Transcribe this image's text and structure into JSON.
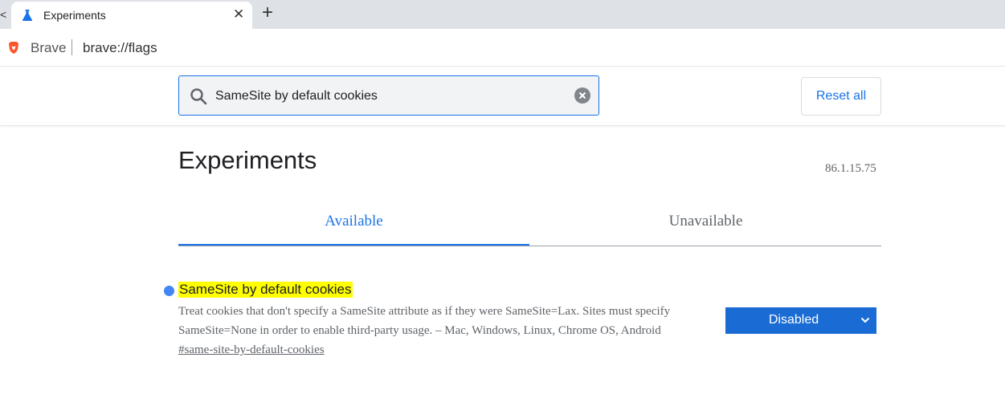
{
  "tabstrip": {
    "scroll_glyph": "<",
    "tab_title": "Experiments",
    "close_glyph": "✕",
    "new_tab_glyph": "+"
  },
  "omnibox": {
    "site_label": "Brave",
    "url": "brave://flags"
  },
  "search": {
    "value": "SameSite by default cookies",
    "reset_label": "Reset all"
  },
  "page": {
    "title": "Experiments",
    "version": "86.1.15.75"
  },
  "tabs": [
    {
      "label": "Available",
      "selected": true
    },
    {
      "label": "Unavailable",
      "selected": false
    }
  ],
  "experiment": {
    "name": "SameSite by default cookies",
    "description": "Treat cookies that don't specify a SameSite attribute as if they were SameSite=Lax. Sites must specify SameSite=None in order to enable third-party usage. – Mac, Windows, Linux, Chrome OS, Android",
    "link": "#same-site-by-default-cookies",
    "state": "Disabled"
  },
  "icons": {
    "tab": "flask-icon",
    "omnibox": "brave-lion-icon",
    "search": "search-icon",
    "clear": "clear-icon",
    "select": "chevron-down-icon"
  },
  "colors": {
    "accent": "#1a73e8",
    "highlight": "#ffff00",
    "select_bg": "#1a6cd4",
    "dot": "#4285f4"
  }
}
